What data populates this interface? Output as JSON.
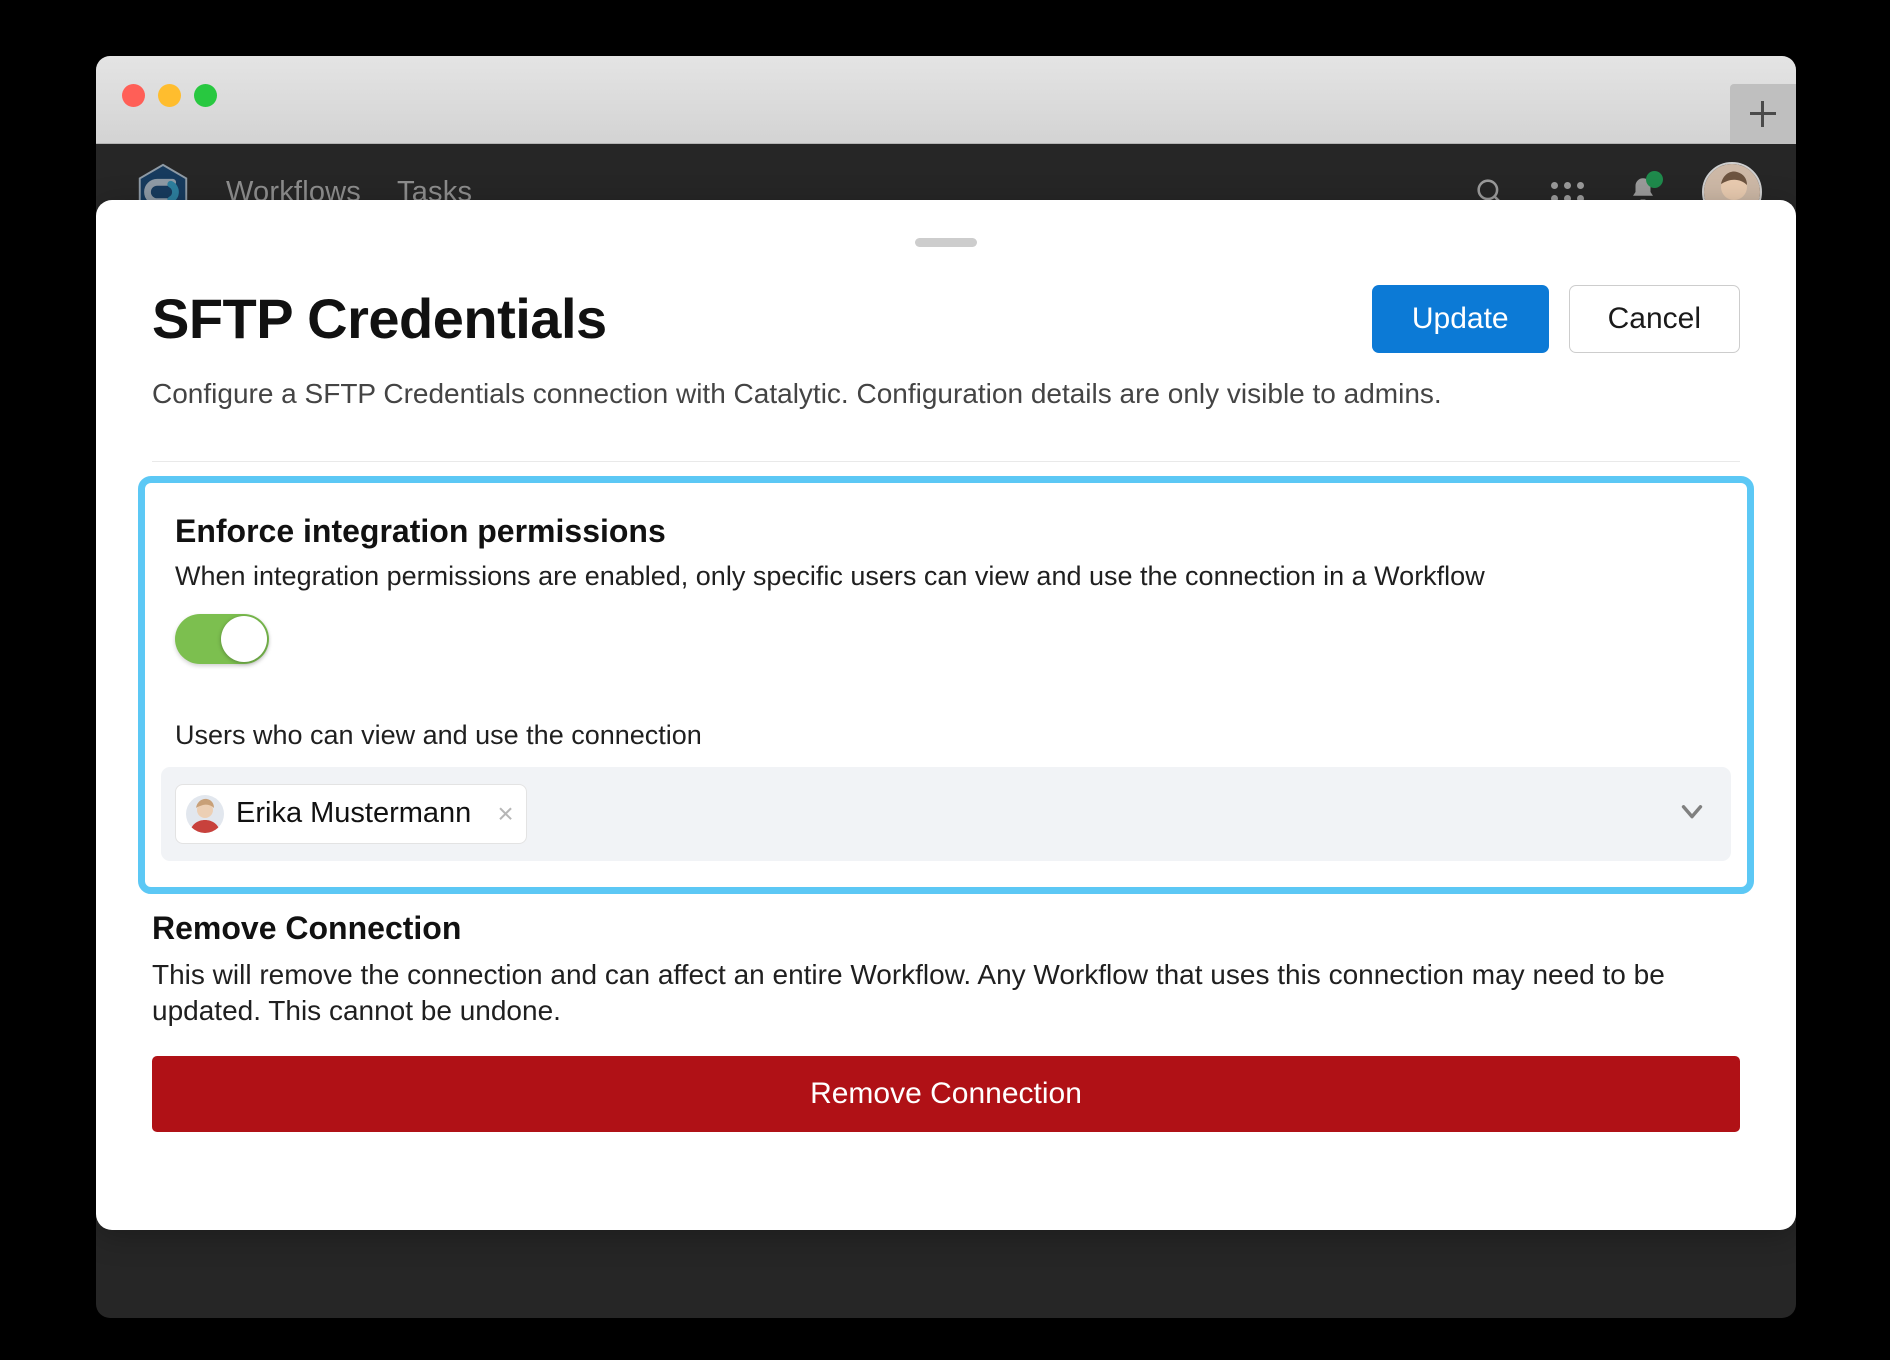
{
  "browser": {
    "traffic_lights": [
      "close",
      "minimize",
      "maximize"
    ],
    "new_tab_label": "+"
  },
  "app_nav": {
    "logo_name": "catalytic-logo",
    "links": [
      {
        "label": "Workflows"
      },
      {
        "label": "Tasks"
      }
    ],
    "icons": [
      {
        "name": "search-icon"
      },
      {
        "name": "apps-grid-icon"
      },
      {
        "name": "notification-bell-icon",
        "badge": true
      }
    ],
    "avatar_name": "user-avatar"
  },
  "modal": {
    "title": "SFTP Credentials",
    "subtitle": "Configure a SFTP Credentials connection with Catalytic. Configuration details are only visible to admins.",
    "update_label": "Update",
    "cancel_label": "Cancel"
  },
  "permissions": {
    "heading": "Enforce integration permissions",
    "description": "When integration permissions are enabled, only specific users can view and use the connection in a Workflow",
    "toggle_state": "on",
    "users_label": "Users who can view and use the connection",
    "selected_users": [
      {
        "name": "Erika Mustermann",
        "remove_label": "×"
      }
    ],
    "highlight_color": "#5cc8f5"
  },
  "remove": {
    "heading": "Remove Connection",
    "description": "This will remove the connection and can affect an entire Workflow. Any Workflow that uses this connection may need to be updated. This cannot be undone.",
    "button_label": "Remove Connection",
    "button_color": "#b01116"
  }
}
